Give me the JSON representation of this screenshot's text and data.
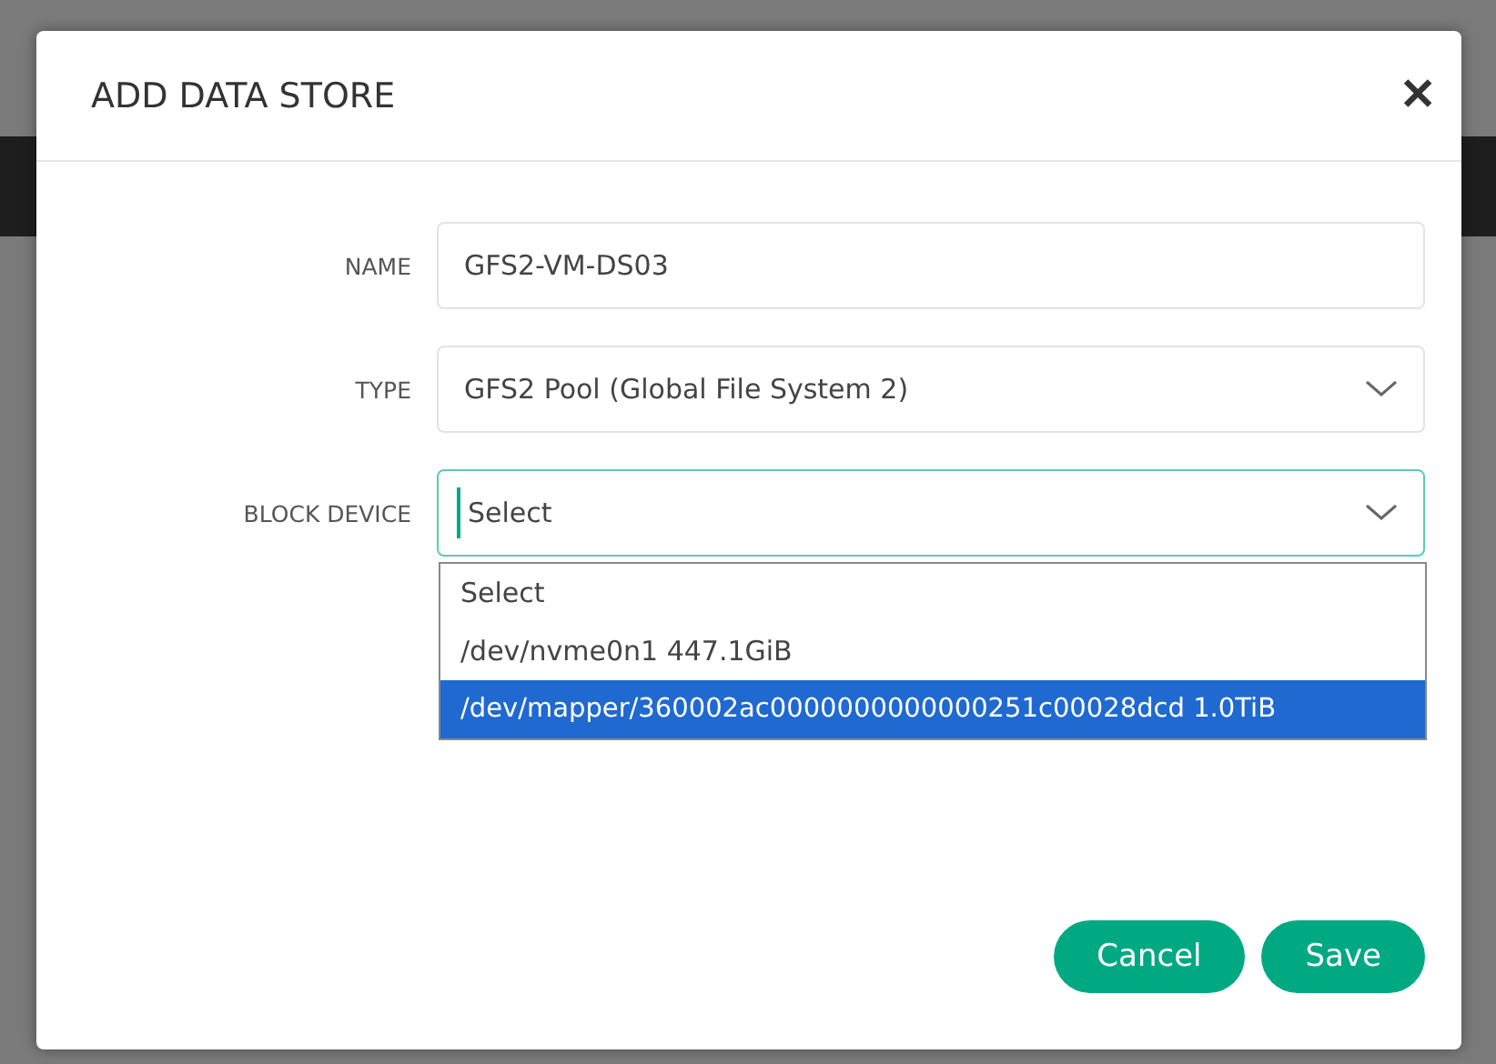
{
  "dialog": {
    "title": "ADD DATA STORE",
    "close": "✕"
  },
  "fields": [
    {
      "label": "NAME",
      "kind": "text",
      "value": "GFS2-VM-DS03",
      "focused": false
    },
    {
      "label": "TYPE",
      "kind": "select",
      "value": "GFS2 Pool (Global File System 2)",
      "focused": false
    },
    {
      "label": "BLOCK DEVICE",
      "kind": "select",
      "value": "Select",
      "focused": true
    }
  ],
  "dropdown_options": [
    {
      "label": "Select",
      "selected": false
    },
    {
      "label": "/dev/nvme0n1 447.1GiB",
      "selected": false
    },
    {
      "label": "/dev/mapper/360002ac0000000000000251c00028dcd 1.0TiB",
      "selected": true
    }
  ],
  "buttons": [
    "Cancel",
    "Save"
  ]
}
